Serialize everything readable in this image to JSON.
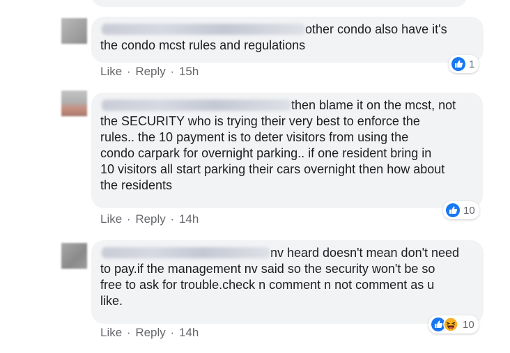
{
  "comments": [
    {
      "text_lines": [
        "other condo also have it's",
        "the condo mcst rules and regulations"
      ],
      "actions": {
        "like": "Like",
        "sep": "·",
        "reply": "Reply",
        "time": "15h"
      },
      "reactions": {
        "icons": [
          "like-icon"
        ],
        "count": "1"
      }
    },
    {
      "text_lines": [
        "then blame it on the mcst, not",
        "the SECURITY who is trying their very best to enforce the",
        "rules.. the 10 payment is to deter visitors from using the",
        "condo carpark for overnight parking.. if one resident bring in",
        "10 visitors all start parking their cars overnight then how about",
        "the residents"
      ],
      "actions": {
        "like": "Like",
        "sep": "·",
        "reply": "Reply",
        "time": "14h"
      },
      "reactions": {
        "icons": [
          "like-icon"
        ],
        "count": "10"
      }
    },
    {
      "text_lines": [
        "nv heard doesn't mean don't need",
        "to pay.if the management nv said so the security won't be so",
        "free to ask for trouble.check n comment n not comment as u",
        "like."
      ],
      "actions": {
        "like": "Like",
        "sep": "·",
        "reply": "Reply",
        "time": "14h"
      },
      "reactions": {
        "icons": [
          "like-icon",
          "haha-icon"
        ],
        "count": "10"
      }
    }
  ],
  "colors": {
    "like_blue": "#1877f2",
    "bubble_bg": "#f2f3f5",
    "muted_text": "#65676b",
    "haha_yellow": "#f7b125"
  }
}
